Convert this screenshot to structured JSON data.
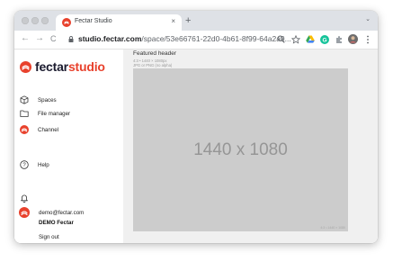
{
  "browser": {
    "tab_title": "Fectar Studio",
    "tab_close": "×",
    "new_tab": "+",
    "tabs_menu": "⌄",
    "back": "←",
    "forward": "→",
    "reload": "C",
    "url_domain": "studio.fectar.com",
    "url_path": "/space/53e66761-22d0-4b61-8f99-64a2a9...",
    "toolbar_icons": [
      "zoom-icon",
      "star-icon",
      "drive-icon",
      "grammarly-icon",
      "extensions-icon",
      "profile-avatar",
      "kebab-menu-icon"
    ]
  },
  "brand": {
    "name_part1": "fectar",
    "name_part2": "studio",
    "color_dark": "#1a1a2e",
    "color_accent": "#e8412c"
  },
  "sidebar": {
    "items": [
      {
        "label": "Spaces",
        "icon": "cube-icon"
      },
      {
        "label": "File manager",
        "icon": "folder-icon"
      },
      {
        "label": "Channel",
        "icon": "fectar-logo-icon"
      }
    ],
    "help_label": "Help",
    "help_icon": "help-circle-icon",
    "notifications_icon": "bell-icon",
    "user": {
      "email": "demo@fectar.com",
      "name": "DEMO Fectar",
      "avatar_icon": "fectar-logo-icon"
    },
    "signout_label": "Sign out"
  },
  "main": {
    "section_title": "Featured header",
    "meta_ratio": "4:3 • 1440 × 1080px",
    "meta_format": "JPG or PNG (no alpha)",
    "placeholder_text": "1440 x 1080",
    "placeholder_note": "4:3 • 1440 × 1080",
    "bg_color": "#f0f0f0",
    "placeholder_color": "#cccccc"
  }
}
